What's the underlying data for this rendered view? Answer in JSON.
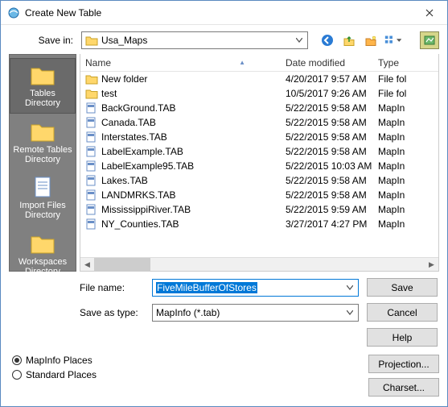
{
  "window": {
    "title": "Create New Table"
  },
  "savein": {
    "label": "Save in:",
    "value": "Usa_Maps"
  },
  "places": [
    {
      "label": "Tables Directory",
      "icon": "folder",
      "selected": true
    },
    {
      "label": "Remote Tables Directory",
      "icon": "folder",
      "selected": false
    },
    {
      "label": "Import Files Directory",
      "icon": "doc",
      "selected": false
    },
    {
      "label": "Workspaces Directory",
      "icon": "folder",
      "selected": false
    }
  ],
  "columns": {
    "name": "Name",
    "date": "Date modified",
    "type": "Type"
  },
  "rows": [
    {
      "name": "New folder",
      "date": "4/20/2017 9:57 AM",
      "type": "File fol",
      "icon": "folder"
    },
    {
      "name": "test",
      "date": "10/5/2017 9:26 AM",
      "type": "File fol",
      "icon": "folder"
    },
    {
      "name": "BackGround.TAB",
      "date": "5/22/2015 9:58 AM",
      "type": "MapIn",
      "icon": "tab"
    },
    {
      "name": "Canada.TAB",
      "date": "5/22/2015 9:58 AM",
      "type": "MapIn",
      "icon": "tab"
    },
    {
      "name": "Interstates.TAB",
      "date": "5/22/2015 9:58 AM",
      "type": "MapIn",
      "icon": "tab"
    },
    {
      "name": "LabelExample.TAB",
      "date": "5/22/2015 9:58 AM",
      "type": "MapIn",
      "icon": "tab"
    },
    {
      "name": "LabelExample95.TAB",
      "date": "5/22/2015 10:03 AM",
      "type": "MapIn",
      "icon": "tab"
    },
    {
      "name": "Lakes.TAB",
      "date": "5/22/2015 9:58 AM",
      "type": "MapIn",
      "icon": "tab"
    },
    {
      "name": "LANDMRKS.TAB",
      "date": "5/22/2015 9:58 AM",
      "type": "MapIn",
      "icon": "tab"
    },
    {
      "name": "MississippiRiver.TAB",
      "date": "5/22/2015 9:59 AM",
      "type": "MapIn",
      "icon": "tab"
    },
    {
      "name": "NY_Counties.TAB",
      "date": "3/27/2017 4:27 PM",
      "type": "MapIn",
      "icon": "tab"
    }
  ],
  "filename": {
    "label": "File name:",
    "value": "FiveMileBufferOfStores"
  },
  "savetype": {
    "label": "Save as type:",
    "value": "MapInfo (*.tab)"
  },
  "buttons": {
    "save": "Save",
    "cancel": "Cancel",
    "help": "Help",
    "projection": "Projection...",
    "charset": "Charset..."
  },
  "radios": {
    "mapinfo": "MapInfo Places",
    "standard": "Standard Places",
    "selected": "mapinfo"
  }
}
